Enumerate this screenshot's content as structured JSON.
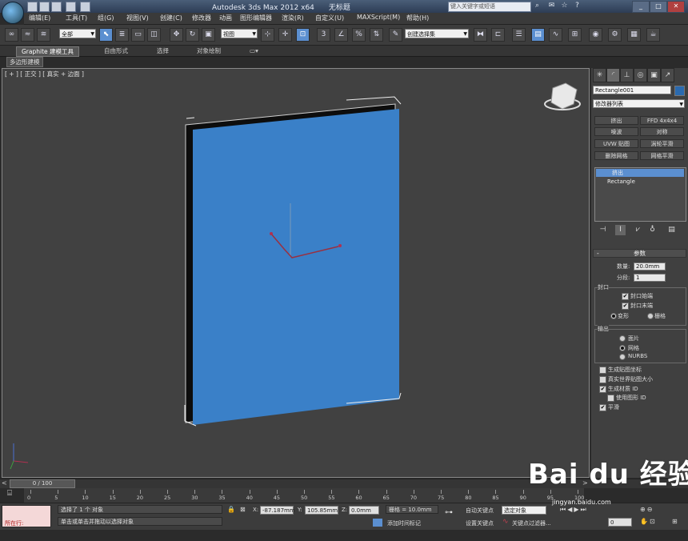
{
  "titlebar": {
    "app": "Autodesk 3ds Max  2012 x64",
    "doc": "无标题",
    "search_placeholder": "键入关键字或短语"
  },
  "menu": [
    "编辑(E)",
    "工具(T)",
    "组(G)",
    "视图(V)",
    "创建(C)",
    "修改器",
    "动画",
    "图形编辑器",
    "渲染(R)",
    "自定义(U)",
    "MAXScript(M)",
    "帮助(H)"
  ],
  "toolbar": {
    "selection_filter": "全部",
    "ref_coord": "视图",
    "named_selection": "创建选择集",
    "snap_label": "3"
  },
  "ribbon": {
    "tabs": [
      "Graphite 建模工具",
      "自由形式",
      "选择",
      "对象绘制"
    ],
    "sub": "多边形建模"
  },
  "viewport": {
    "label": "[ + ] [ 正交 ] [ 真实 + 边面 ]"
  },
  "command_panel": {
    "object_name": "Rectangle001",
    "modifier_list": "修改器列表",
    "modifier_buttons": [
      "挤出",
      "FFD 4x4x4",
      "噪波",
      "对称",
      "UVW 贴图",
      "涡轮平滑",
      "删除网格",
      "网格平滑"
    ],
    "stack": [
      "挤出",
      "Rectangle"
    ],
    "params_title": "参数",
    "amount_label": "数量:",
    "amount_value": "20.0mm",
    "segments_label": "分段:",
    "segments_value": "1",
    "capping_group": "封口",
    "cap_start": "封口始端",
    "cap_end": "封口末端",
    "morph": "变形",
    "grid": "栅格",
    "output_group": "输出",
    "patch": "面片",
    "mesh": "网格",
    "nurbs": "NURBS",
    "gen_map_coords": "生成贴图坐标",
    "real_world": "真实世界贴图大小",
    "gen_mat_ids": "生成材质 ID",
    "use_shape_ids": "使用图形 ID",
    "smooth": "平滑",
    "checks": {
      "cap_start": true,
      "cap_end": true,
      "gen_map_coords": false,
      "real_world": false,
      "gen_mat_ids": true,
      "use_shape_ids": false,
      "smooth": true
    },
    "capping_type": "变形",
    "output_type": "网格"
  },
  "timeline": {
    "slider": "0 / 100",
    "ticks": [
      "0",
      "5",
      "10",
      "15",
      "20",
      "25",
      "30",
      "35",
      "40",
      "45",
      "50",
      "55",
      "60",
      "65",
      "70",
      "75",
      "80",
      "85",
      "90",
      "95",
      "100"
    ]
  },
  "status": {
    "maxscript": "所在行:",
    "selected": "选择了 1 个 对象",
    "prompt": "单击或单击并拖动以选择对象",
    "x_label": "X:",
    "x": "-87.187mm",
    "y_label": "Y:",
    "y": "105.85mm",
    "z_label": "Z:",
    "z": "0.0mm",
    "grid": "栅格 = 10.0mm",
    "autokey": "自动关键点",
    "selected_obj": "选定对象",
    "setkey": "设置关键点",
    "key_filters": "关键点过滤器...",
    "add_time_tag": "添加时间标记",
    "frame": "0"
  },
  "watermark": {
    "brand": "Bai du 经验",
    "url": "jingyan.baidu.com"
  },
  "colors": {
    "box": "#3a80c8",
    "accent": "#5b8fd0",
    "panel": "#404040"
  }
}
